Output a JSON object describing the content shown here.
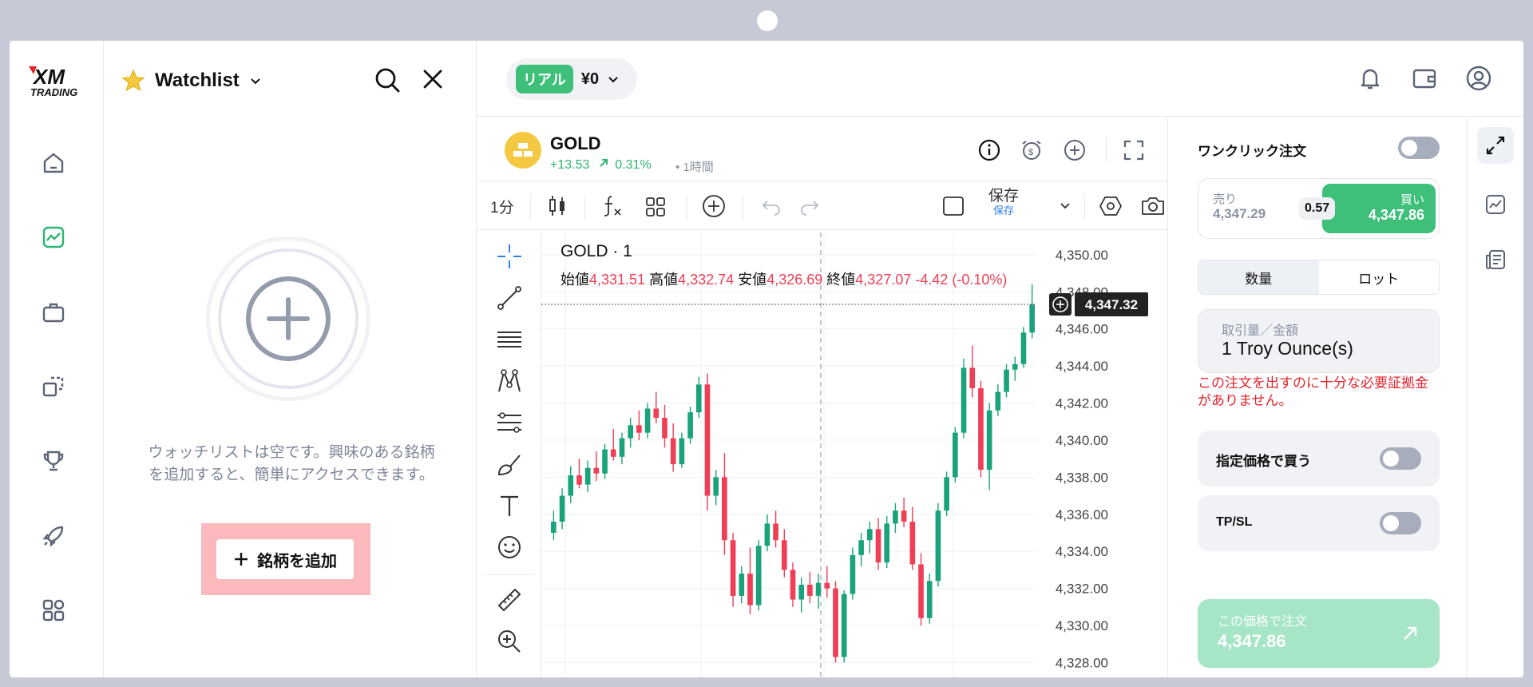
{
  "nav": {
    "logo_text": "XM",
    "logo_sub": "TRADING",
    "items": [
      "home",
      "chart",
      "portfolio",
      "copy",
      "trophy",
      "rocket",
      "apps"
    ]
  },
  "watchlist": {
    "title": "Watchlist",
    "empty_message": "ウォッチリストは空です。興味のある銘柄を追加すると、簡単にアクセスできます。",
    "add_label": "銘柄を追加"
  },
  "topbar": {
    "account_badge": "リアル",
    "balance": "¥0"
  },
  "symbol": {
    "name": "GOLD",
    "change": "+13.53",
    "change_pct": "0.31%",
    "timeframe": "• 1時間"
  },
  "toolbar": {
    "interval": "1分",
    "save_label": "保存",
    "save_sub": "保存"
  },
  "chart_data": {
    "type": "candlestick",
    "title": "GOLD · 1",
    "ohlc_labels": {
      "open_label": "始値",
      "open": "4,331.51",
      "high_label": "高値",
      "high": "4,332.74",
      "low_label": "安値",
      "low": "4,326.69",
      "close_label": "終値",
      "close": "4,327.07",
      "change": "-4.42 (-0.10%)"
    },
    "y_ticks": [
      "4,350.00",
      "4,348.00",
      "4,346.00",
      "4,344.00",
      "4,342.00",
      "4,340.00",
      "4,338.00",
      "4,336.00",
      "4,334.00",
      "4,332.00",
      "4,330.00",
      "4,328.00"
    ],
    "ylim": [
      4327.2,
      4351.2
    ],
    "current_price": "4,347.32",
    "current_price_value": 4347.32,
    "up_color": "#1aa37a",
    "down_color": "#ef3e55",
    "candles": [
      [
        4335.0,
        4336.2,
        4334.6,
        4335.6
      ],
      [
        4335.6,
        4337.4,
        4335.2,
        4337.0
      ],
      [
        4337.0,
        4338.6,
        4336.6,
        4338.1
      ],
      [
        4338.1,
        4339.0,
        4337.4,
        4337.6
      ],
      [
        4337.6,
        4338.9,
        4337.2,
        4338.5
      ],
      [
        4338.5,
        4339.4,
        4337.8,
        4338.2
      ],
      [
        4338.2,
        4339.8,
        4337.9,
        4339.5
      ],
      [
        4339.5,
        4340.6,
        4338.9,
        4339.1
      ],
      [
        4339.1,
        4340.4,
        4338.7,
        4340.1
      ],
      [
        4340.1,
        4341.2,
        4339.6,
        4340.8
      ],
      [
        4340.8,
        4341.6,
        4340.0,
        4340.4
      ],
      [
        4340.4,
        4342.0,
        4340.1,
        4341.7
      ],
      [
        4341.7,
        4342.6,
        4340.9,
        4341.2
      ],
      [
        4341.2,
        4341.9,
        4339.6,
        4340.1
      ],
      [
        4340.1,
        4340.9,
        4338.3,
        4338.7
      ],
      [
        4338.7,
        4340.4,
        4338.5,
        4340.1
      ],
      [
        4340.1,
        4341.8,
        4339.8,
        4341.5
      ],
      [
        4341.5,
        4343.4,
        4341.2,
        4343.0
      ],
      [
        4343.0,
        4343.6,
        4336.2,
        4337.0
      ],
      [
        4337.0,
        4338.4,
        4336.5,
        4338.0
      ],
      [
        4338.0,
        4339.3,
        4333.8,
        4334.6
      ],
      [
        4334.6,
        4335.0,
        4331.0,
        4331.6
      ],
      [
        4331.6,
        4333.2,
        4331.2,
        4332.8
      ],
      [
        4332.8,
        4334.2,
        4330.6,
        4331.1
      ],
      [
        4331.1,
        4334.6,
        4330.8,
        4334.3
      ],
      [
        4334.3,
        4336.0,
        4334.0,
        4335.5
      ],
      [
        4335.5,
        4336.2,
        4334.2,
        4334.6
      ],
      [
        4334.6,
        4335.2,
        4332.6,
        4333.0
      ],
      [
        4333.0,
        4333.4,
        4331.0,
        4331.4
      ],
      [
        4331.4,
        4332.6,
        4330.7,
        4332.2
      ],
      [
        4332.2,
        4332.9,
        4331.2,
        4331.6
      ],
      [
        4331.6,
        4332.8,
        4330.9,
        4332.3
      ],
      [
        4332.3,
        4333.2,
        4331.5,
        4332.0
      ],
      [
        4332.0,
        4332.4,
        4328.0,
        4328.3
      ],
      [
        4328.3,
        4331.9,
        4328.0,
        4331.7
      ],
      [
        4331.7,
        4334.2,
        4331.4,
        4333.8
      ],
      [
        4333.8,
        4335.0,
        4333.2,
        4334.6
      ],
      [
        4334.6,
        4335.6,
        4333.9,
        4335.2
      ],
      [
        4335.2,
        4335.8,
        4333.0,
        4333.4
      ],
      [
        4333.4,
        4335.9,
        4333.1,
        4335.5
      ],
      [
        4335.5,
        4336.6,
        4335.0,
        4336.2
      ],
      [
        4336.2,
        4336.9,
        4335.3,
        4335.6
      ],
      [
        4335.6,
        4336.4,
        4333.0,
        4333.3
      ],
      [
        4333.3,
        4333.9,
        4330.0,
        4330.4
      ],
      [
        4330.4,
        4332.8,
        4330.1,
        4332.4
      ],
      [
        4332.4,
        4336.6,
        4332.1,
        4336.2
      ],
      [
        4336.2,
        4338.3,
        4335.9,
        4338.0
      ],
      [
        4338.0,
        4340.7,
        4337.7,
        4340.4
      ],
      [
        4340.4,
        4344.4,
        4340.1,
        4343.9
      ],
      [
        4343.9,
        4345.1,
        4342.3,
        4342.8
      ],
      [
        4342.8,
        4343.2,
        4338.0,
        4338.4
      ],
      [
        4338.4,
        4342.0,
        4337.3,
        4341.6
      ],
      [
        4341.6,
        4343.0,
        4341.3,
        4342.6
      ],
      [
        4342.6,
        4344.1,
        4342.3,
        4343.8
      ],
      [
        4343.8,
        4344.5,
        4343.2,
        4344.1
      ],
      [
        4344.1,
        4346.1,
        4343.9,
        4345.8
      ],
      [
        4345.8,
        4348.4,
        4345.5,
        4347.3
      ]
    ]
  },
  "order": {
    "oneclick_label": "ワンクリック注文",
    "sell_label": "売り",
    "sell_price": "4,347.29",
    "spread": "0.57",
    "buy_label": "買い",
    "buy_price": "4,347.86",
    "tab_qty": "数量",
    "tab_lot": "ロット",
    "amount_label": "取引量／金額",
    "amount_value": "1 Troy Ounce(s)",
    "error": "この注文を出すのに十分な必要証拠金がありません。",
    "limit_label": "指定価格で買う",
    "tpsl_label": "TP/SL",
    "submit_label": "この価格で注文",
    "submit_price": "4,347.86"
  },
  "colors": {
    "accent": "#3ec07b",
    "red": "#ef3e55",
    "muted": "#8a93a5"
  }
}
